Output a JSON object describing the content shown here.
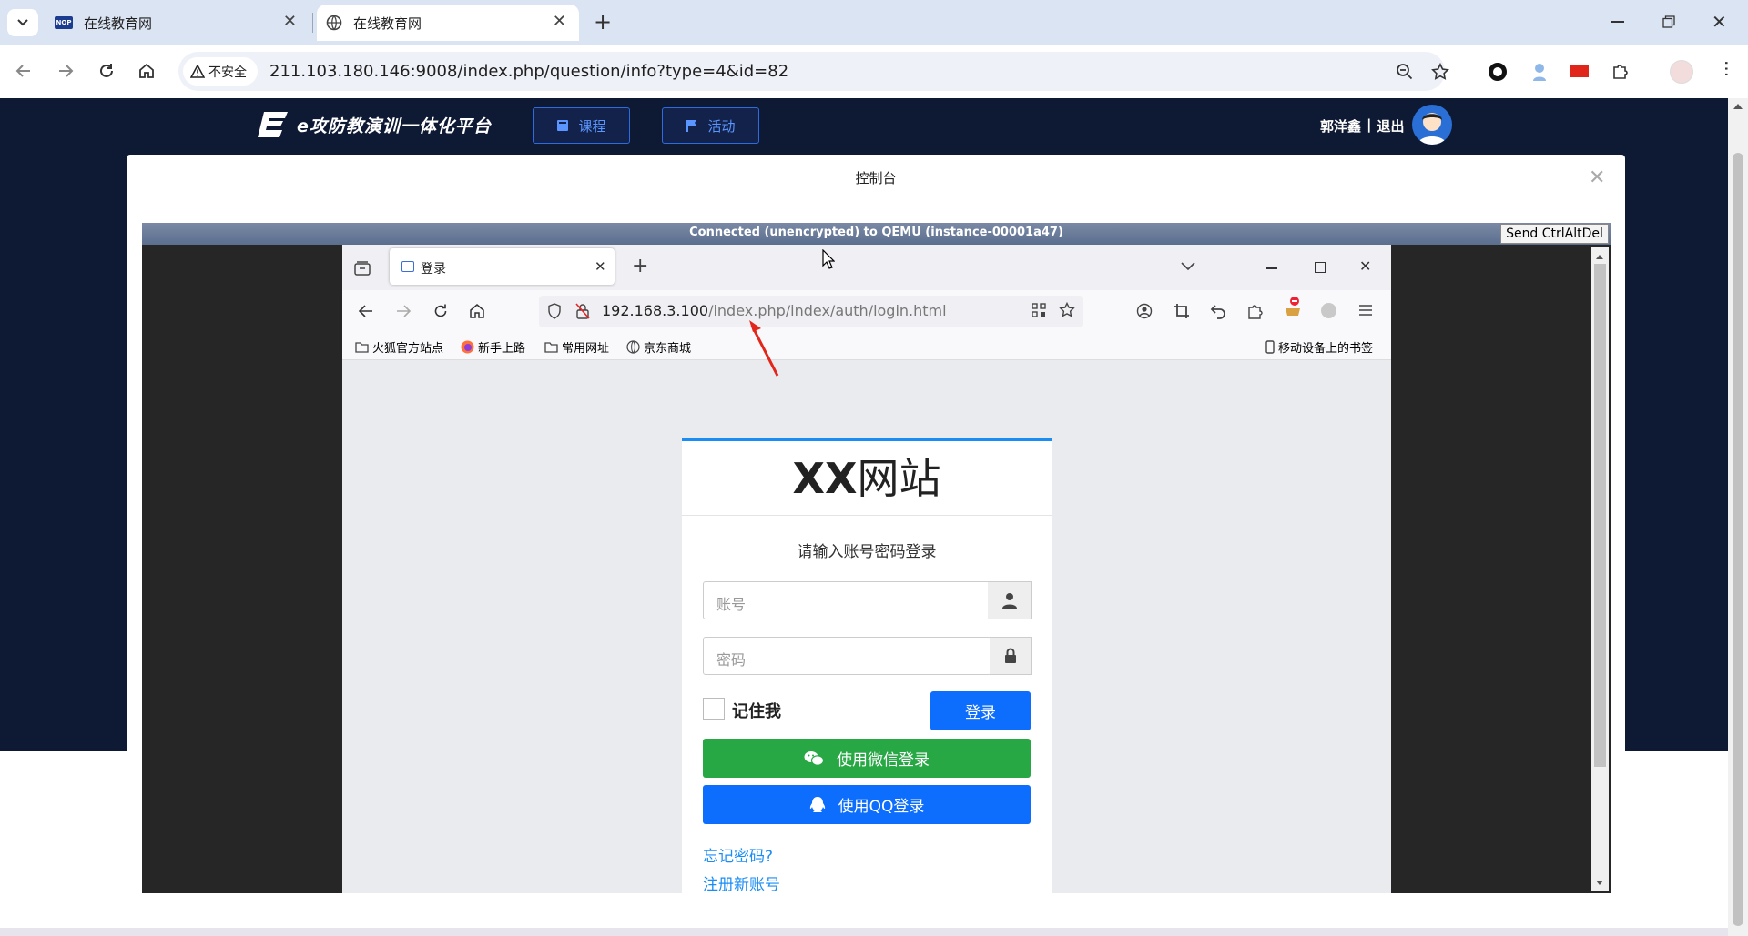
{
  "outer_browser": {
    "tabs": [
      {
        "title": "在线教育网",
        "active": false
      },
      {
        "title": "在线教育网",
        "active": true
      }
    ],
    "security_label": "不安全",
    "url": "211.103.180.146:9008/index.php/question/info?type=4&id=82",
    "favicon_text": "NOP"
  },
  "app": {
    "logo_text": "e攻防教演训一体化平台",
    "nav": [
      "课程",
      "活动"
    ],
    "user_name": "郭洋鑫",
    "user_sep": "|",
    "logout": "退出"
  },
  "modal": {
    "title": "控制台",
    "vnc_status": "Connected (unencrypted) to QEMU (instance-00001a47)",
    "ctrl_alt_del": "Send CtrlAltDel"
  },
  "firefox": {
    "tab_title": "登录",
    "url_host": "192.168.3.100",
    "url_path": "/index.php/index/auth/login.html",
    "bookmarks": [
      "火狐官方站点",
      "新手上路",
      "常用网址",
      "京东商城"
    ],
    "mobile_bookmarks": "移动设备上的书签"
  },
  "login": {
    "site_title_bold": "XX",
    "site_title_rest": "网站",
    "prompt": "请输入账号密码登录",
    "account_placeholder": "账号",
    "password_placeholder": "密码",
    "remember": "记住我",
    "login_button": "登录",
    "wechat_login": "使用微信登录",
    "qq_login": "使用QQ登录",
    "forgot": "忘记密码?",
    "register": "注册新账号"
  },
  "colors": {
    "app_header_bg": "#0e1933",
    "primary": "#0d6efd",
    "wechat_green": "#28a745",
    "link_blue": "#1a8df5"
  }
}
